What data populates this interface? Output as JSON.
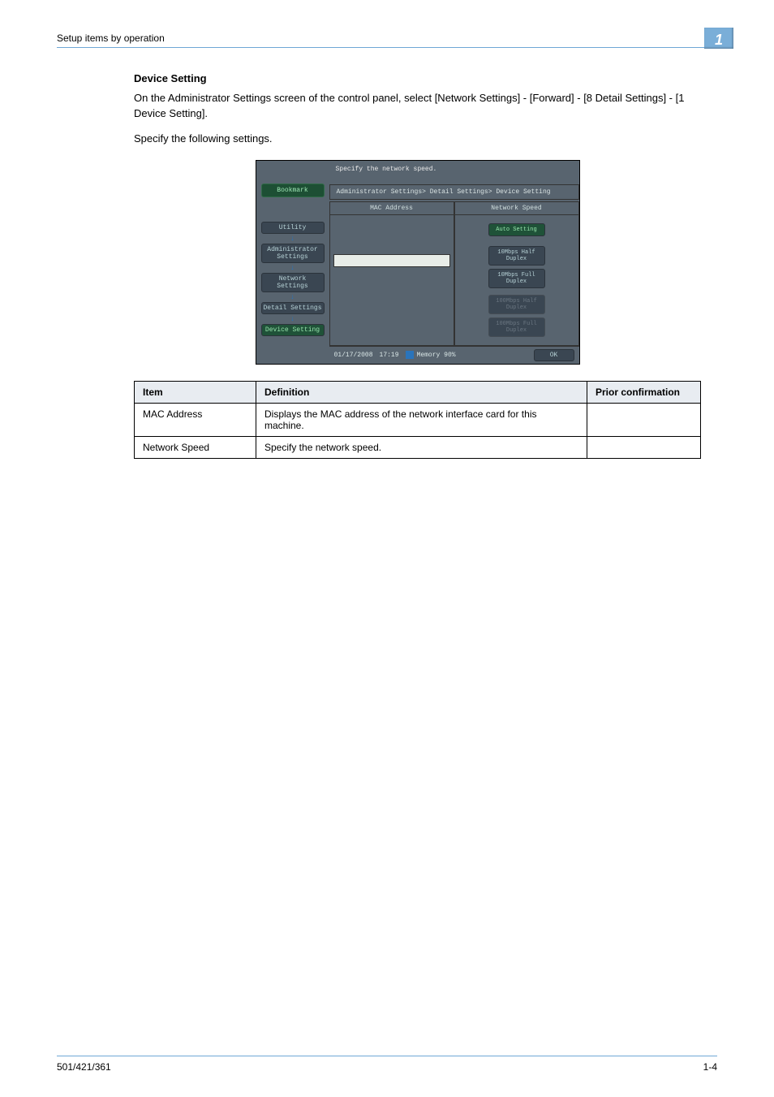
{
  "header": {
    "breadcrumb": "Setup items by operation",
    "chapter_number": "1"
  },
  "section": {
    "title": "Device Setting",
    "para1": "On the Administrator Settings screen of the control panel, select [Network Settings] - [Forward] - [8 Detail Settings] - [1 Device Setting].",
    "para2": "Specify the following settings."
  },
  "panel": {
    "instruction": "Specify the network speed.",
    "bookmark_label": "Bookmark",
    "breadcrumb": "Administrator Settings> Detail Settings> Device Setting",
    "nav": [
      {
        "label": "Utility",
        "active": false
      },
      {
        "label": "Administrator Settings",
        "active": false
      },
      {
        "label": "Network Settings",
        "active": false
      },
      {
        "label": "Detail Settings",
        "active": false
      },
      {
        "label": "Device Setting",
        "active": true
      }
    ],
    "col_left_header": "MAC Address",
    "col_right_header": "Network Speed",
    "speed_options": {
      "auto": "Auto Setting",
      "ten_half": "10Mbps Half Duplex",
      "ten_full": "10Mbps Full Duplex",
      "hundred_half": "100Mbps Half Duplex",
      "hundred_full": "100Mbps Full Duplex"
    },
    "footer": {
      "date": "01/17/2008",
      "time": "17:19",
      "memory_label": "Memory",
      "memory_value": "90%",
      "ok_label": "OK"
    }
  },
  "table": {
    "headers": {
      "item": "Item",
      "definition": "Definition",
      "prior": "Prior confirmation"
    },
    "rows": [
      {
        "item": "MAC Address",
        "definition": "Displays the MAC address of the network interface card for this machine.",
        "prior": ""
      },
      {
        "item": "Network Speed",
        "definition": "Specify the network speed.",
        "prior": ""
      }
    ]
  },
  "footer": {
    "model": "501/421/361",
    "page": "1-4"
  }
}
